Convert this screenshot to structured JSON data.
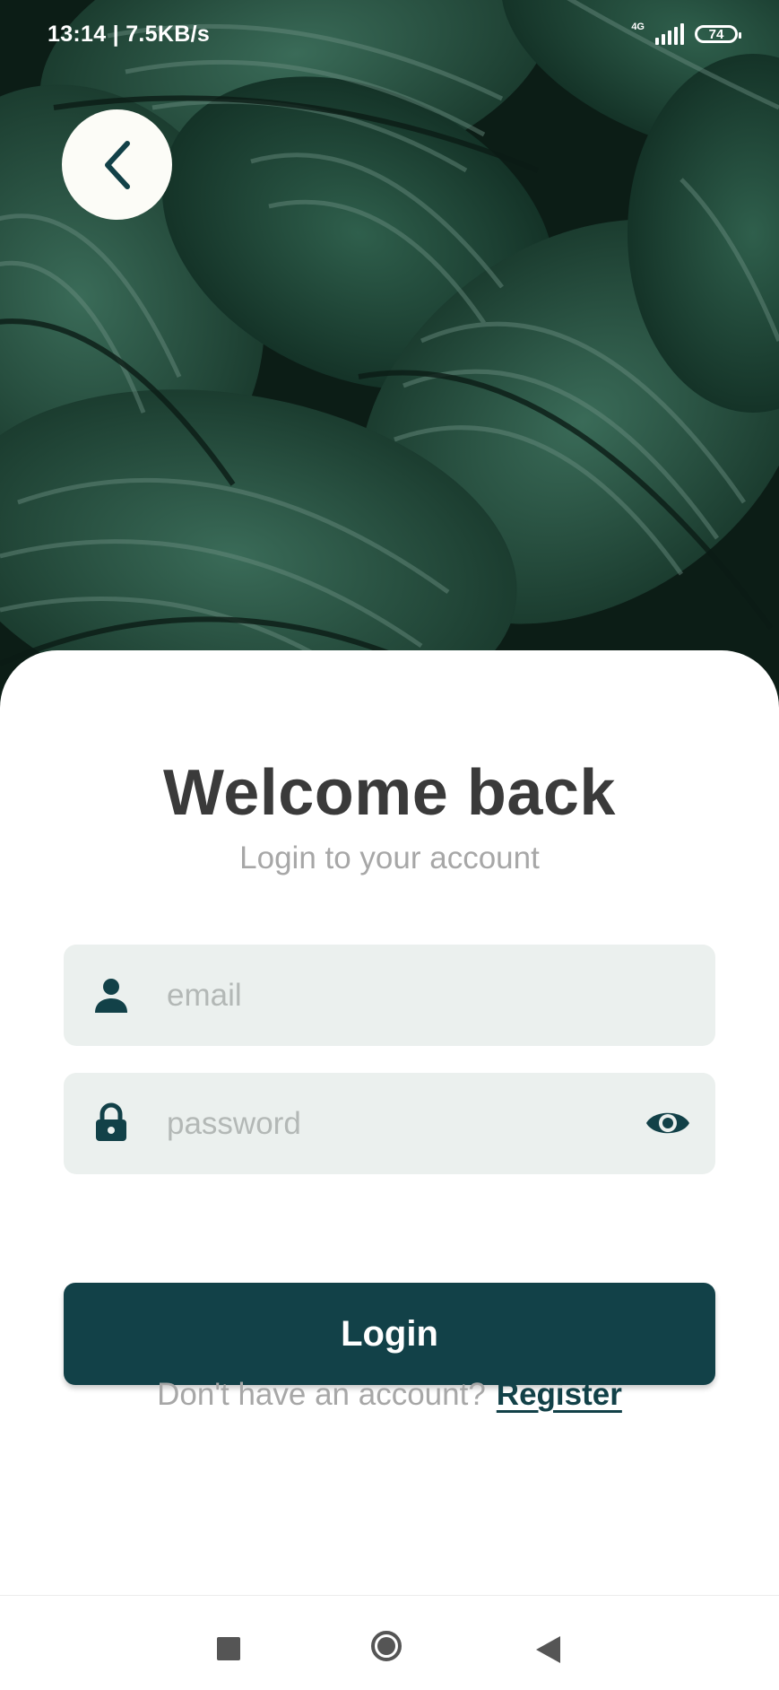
{
  "status_bar": {
    "time_speed": "13:14 | 7.5KB/s",
    "network": "4G",
    "battery": "74"
  },
  "hero": {
    "image_icon": "leaf-background-image",
    "back_icon": "chevron-left-icon"
  },
  "login": {
    "title": "Welcome back",
    "subtitle": "Login to your account",
    "email_placeholder": "email",
    "password_placeholder": "password",
    "login_label": "Login",
    "register_prompt": "Don't have an account?",
    "register_label": "Register"
  },
  "colors": {
    "primary": "#124148",
    "field_bg": "#ebf0ee",
    "title": "#3a3a3a",
    "muted": "#a7a7a7"
  },
  "nav": {
    "recents_icon": "square-icon",
    "home_icon": "circle-icon",
    "back_icon": "triangle-back-icon"
  }
}
